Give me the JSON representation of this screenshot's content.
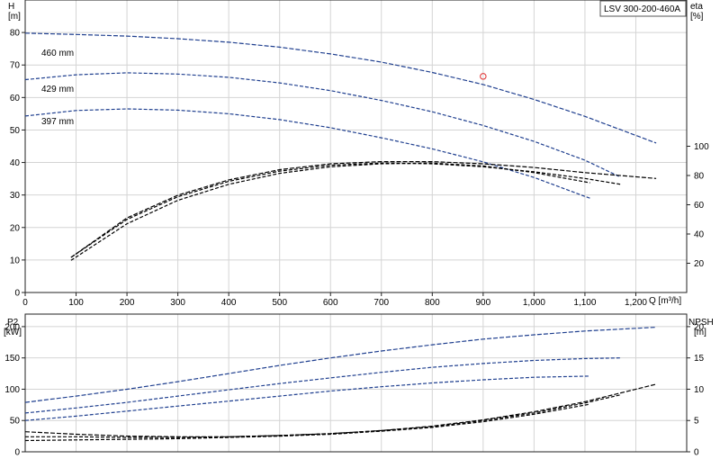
{
  "chart_data": [
    {
      "type": "line",
      "title": "LSV 300-200-460A",
      "xlabel": "Q [m³/h]",
      "ylabel_left": "H",
      "ylabel_left_unit": "[m]",
      "ylabel_right": "eta",
      "ylabel_right_unit": "[%]",
      "xlim": [
        0,
        1300
      ],
      "ylim": [
        0,
        90
      ],
      "y2lim": [
        0,
        200
      ],
      "x_ticks": [
        0,
        100,
        200,
        300,
        400,
        500,
        600,
        700,
        800,
        900,
        1000,
        1100,
        1200
      ],
      "x_tick_labels": [
        "0",
        "100",
        "200",
        "300",
        "400",
        "500",
        "600",
        "700",
        "800",
        "900",
        "1,000",
        "1,100",
        "1,200"
      ],
      "y_ticks": [
        0,
        10,
        20,
        30,
        40,
        50,
        60,
        70,
        80
      ],
      "y2_ticks": [
        20,
        40,
        60,
        80,
        100
      ],
      "grid": true,
      "duty_point": {
        "x": 900,
        "y": 66.5,
        "color": "#e03030"
      },
      "series": [
        {
          "name": "460 mm",
          "axis": "left",
          "color": "#1f3f8f",
          "x": [
            0,
            100,
            200,
            300,
            400,
            500,
            600,
            700,
            800,
            900,
            1000,
            1100,
            1240
          ],
          "y": [
            79.8,
            79.4,
            78.9,
            78.1,
            77.0,
            75.5,
            73.4,
            70.9,
            67.7,
            64.0,
            59.4,
            54.2,
            46.0
          ]
        },
        {
          "name": "429 mm",
          "axis": "left",
          "color": "#1f3f8f",
          "x": [
            0,
            100,
            200,
            300,
            400,
            500,
            600,
            700,
            800,
            900,
            1000,
            1100,
            1170
          ],
          "y": [
            65.5,
            67.0,
            67.6,
            67.2,
            66.2,
            64.5,
            62.1,
            59.1,
            55.6,
            51.4,
            46.5,
            40.7,
            35.5
          ]
        },
        {
          "name": "397 mm",
          "axis": "left",
          "color": "#1f3f8f",
          "x": [
            0,
            100,
            200,
            300,
            400,
            500,
            600,
            700,
            800,
            900,
            1000,
            1110
          ],
          "y": [
            54.3,
            56.0,
            56.5,
            56.1,
            55.0,
            53.2,
            50.7,
            47.6,
            44.2,
            40.2,
            35.4,
            29.0
          ]
        },
        {
          "name": "",
          "axis": "right",
          "color": "#000000",
          "x": [
            90,
            200,
            300,
            400,
            500,
            600,
            700,
            800,
            900,
            1000,
            1100,
            1240
          ],
          "y": [
            24.0,
            51.0,
            66.5,
            77.0,
            84.0,
            88.0,
            89.5,
            89.5,
            88.0,
            85.5,
            82.0,
            78.0
          ]
        },
        {
          "name": "",
          "axis": "right",
          "color": "#000000",
          "x": [
            90,
            200,
            300,
            400,
            500,
            600,
            700,
            800,
            900,
            1000,
            1100,
            1170
          ],
          "y": [
            24.0,
            50.0,
            65.5,
            76.0,
            83.0,
            87.0,
            88.5,
            88.0,
            86.0,
            82.5,
            78.0,
            74.0
          ]
        },
        {
          "name": "",
          "axis": "right",
          "color": "#000000",
          "x": [
            90,
            200,
            300,
            400,
            500,
            600,
            700,
            800,
            900,
            1000,
            1110
          ],
          "y": [
            22.0,
            47.0,
            63.0,
            74.0,
            81.5,
            86.0,
            88.0,
            88.5,
            86.5,
            82.0,
            75.0
          ]
        }
      ]
    },
    {
      "type": "line",
      "xlabel": "",
      "ylabel_left": "P2",
      "ylabel_left_unit": "[kW]",
      "ylabel_right": "NPSH",
      "ylabel_right_unit": "[m]",
      "xlim": [
        0,
        1300
      ],
      "ylim": [
        0,
        220
      ],
      "y2lim": [
        0,
        22
      ],
      "y_ticks": [
        0,
        50,
        100,
        150,
        200
      ],
      "y2_ticks": [
        0,
        5,
        10,
        15,
        20
      ],
      "grid": true,
      "series": [
        {
          "name": "",
          "axis": "left",
          "color": "#1f3f8f",
          "x": [
            0,
            100,
            200,
            300,
            400,
            500,
            600,
            700,
            800,
            900,
            1000,
            1100,
            1240
          ],
          "y": [
            79,
            89,
            100,
            112,
            125,
            138,
            150,
            161,
            171,
            180,
            187,
            193,
            199
          ]
        },
        {
          "name": "",
          "axis": "left",
          "color": "#1f3f8f",
          "x": [
            0,
            100,
            200,
            300,
            400,
            500,
            600,
            700,
            800,
            900,
            1000,
            1100,
            1170
          ],
          "y": [
            62,
            70,
            79,
            89,
            99,
            109,
            118,
            127,
            135,
            141,
            146,
            149,
            150
          ]
        },
        {
          "name": "",
          "axis": "left",
          "color": "#1f3f8f",
          "x": [
            0,
            100,
            200,
            300,
            400,
            500,
            600,
            700,
            800,
            900,
            1000,
            1110
          ],
          "y": [
            50,
            57,
            65,
            73,
            81,
            89,
            97,
            104,
            110,
            115,
            119,
            121
          ]
        },
        {
          "name": "",
          "axis": "right",
          "color": "#000000",
          "x": [
            0,
            100,
            200,
            300,
            400,
            500,
            600,
            700,
            800,
            900,
            1000,
            1100,
            1240
          ],
          "y": [
            3.2,
            2.8,
            2.5,
            2.4,
            2.4,
            2.6,
            2.9,
            3.4,
            4.1,
            5.1,
            6.4,
            8.0,
            10.8
          ]
        },
        {
          "name": "",
          "axis": "right",
          "color": "#000000",
          "x": [
            0,
            100,
            200,
            300,
            400,
            500,
            600,
            700,
            800,
            900,
            1000,
            1100,
            1170
          ],
          "y": [
            2.4,
            2.4,
            2.3,
            2.3,
            2.4,
            2.6,
            2.9,
            3.4,
            4.0,
            5.0,
            6.2,
            7.8,
            9.1
          ]
        },
        {
          "name": "",
          "axis": "right",
          "color": "#000000",
          "x": [
            0,
            100,
            200,
            300,
            400,
            500,
            600,
            700,
            800,
            900,
            1000,
            1110
          ],
          "y": [
            1.8,
            1.9,
            2.0,
            2.1,
            2.3,
            2.5,
            2.8,
            3.3,
            3.9,
            4.8,
            6.0,
            7.6
          ]
        }
      ]
    }
  ]
}
